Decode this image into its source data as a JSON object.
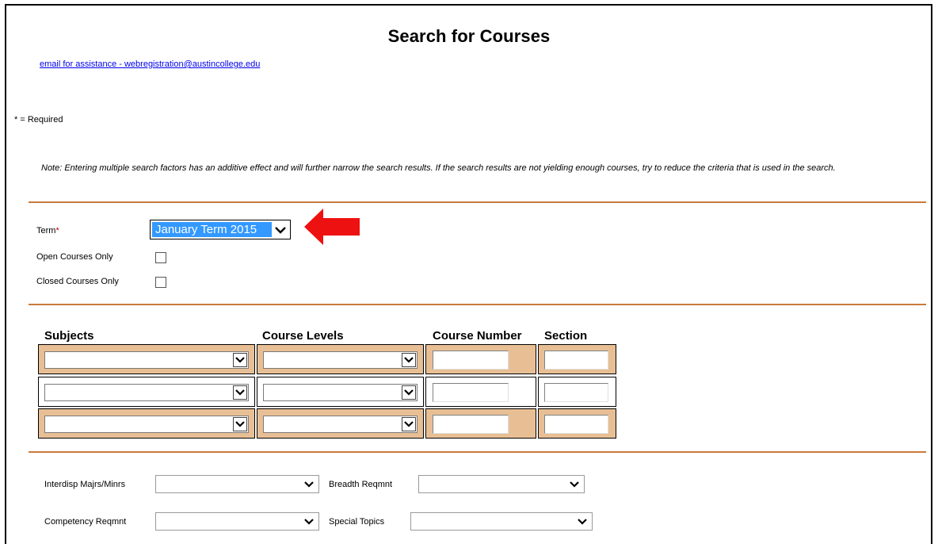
{
  "page": {
    "title": "Search for Courses",
    "email_link": "email for assistance - webregistration@austincollege.edu",
    "required_note": "* = Required",
    "note": "Note: Entering multiple search factors has an additive effect and will further narrow the search results. If the search results are not yielding enough courses, try to reduce the criteria that is used in the search."
  },
  "form": {
    "term_label": "Term",
    "required_marker": "*",
    "term_value": "January Term 2015",
    "open_courses_label": "Open Courses Only",
    "open_courses_checked": false,
    "closed_courses_label": "Closed Courses Only",
    "closed_courses_checked": false
  },
  "grid": {
    "headers": [
      "Subjects",
      "Course Levels",
      "Course Number",
      "Section"
    ],
    "rows": [
      {
        "subject": "",
        "level": "",
        "number": "",
        "section": ""
      },
      {
        "subject": "",
        "level": "",
        "number": "",
        "section": ""
      },
      {
        "subject": "",
        "level": "",
        "number": "",
        "section": ""
      }
    ]
  },
  "filters": {
    "interdisp_label": "Interdisp Majrs/Minrs",
    "breadth_label": "Breadth Reqmnt",
    "competency_label": "Competency Reqmnt",
    "special_topics_label": "Special Topics"
  },
  "colors": {
    "accent_rule": "#c97a3c",
    "row_shade": "#e8bf94",
    "link": "#0000ee",
    "selection": "#3399ff",
    "arrow": "#ee1111"
  },
  "icons": {
    "dropdown": "chevron-down-icon",
    "annotation": "red-arrow-left-icon"
  }
}
